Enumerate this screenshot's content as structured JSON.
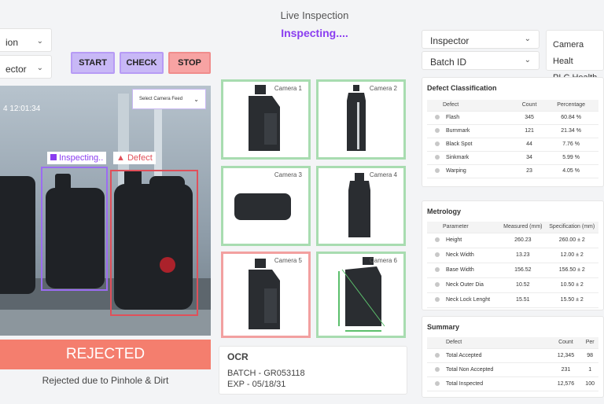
{
  "header": {
    "title": "Live Inspection",
    "status": "Inspecting...."
  },
  "left_controls": {
    "dropdown1_value": "ion",
    "dropdown2_value": "ector"
  },
  "buttons": {
    "start": "START",
    "check": "CHECK",
    "stop": "STOP"
  },
  "video": {
    "timestamp": "4  12:01:34",
    "camera_select": "Select Camera Feed",
    "inspecting_label": "Inspecting..",
    "defect_label": "Defect"
  },
  "result": {
    "verdict": "REJECTED",
    "reason": "Rejected due to Pinhole & Dirt"
  },
  "cameras": [
    {
      "label": "Camera 1",
      "status": "pass"
    },
    {
      "label": "Camera 2",
      "status": "pass"
    },
    {
      "label": "Camera 3",
      "status": "pass"
    },
    {
      "label": "Camera 4",
      "status": "pass"
    },
    {
      "label": "Camera 5",
      "status": "fail"
    },
    {
      "label": "Camera 6",
      "status": "pass"
    }
  ],
  "ocr": {
    "title": "OCR",
    "line1": "BATCH - GR053118",
    "line2": "EXP - 05/18/31"
  },
  "right_controls": {
    "inspector": "Inspector",
    "batch": "Batch ID",
    "camera_health": "Camera Healt",
    "plc_health": "PLC Health"
  },
  "defect_classification": {
    "title": "Defect Classification",
    "headers": [
      "Defect",
      "Count",
      "Percentage",
      ""
    ],
    "rows": [
      {
        "defect": "Flash",
        "count": "345",
        "pct": "60.84 %"
      },
      {
        "defect": "Burnmark",
        "count": "121",
        "pct": "21.34 %"
      },
      {
        "defect": "Black Spot",
        "count": "44",
        "pct": "7.76 %"
      },
      {
        "defect": "Sinkmark",
        "count": "34",
        "pct": "5.99 %"
      },
      {
        "defect": "Warping",
        "count": "23",
        "pct": "4.05 %"
      }
    ]
  },
  "metrology": {
    "title": "Metrology",
    "headers": [
      "Parameter",
      "Measured (mm)",
      "Specification (mm)",
      ""
    ],
    "rows": [
      {
        "param": "Height",
        "measured": "260.23",
        "spec": "260.00 ± 2"
      },
      {
        "param": "Neck Width",
        "measured": "13.23",
        "spec": "12.00 ± 2"
      },
      {
        "param": "Base Width",
        "measured": "156.52",
        "spec": "156.50 ± 2"
      },
      {
        "param": "Neck Outer Dia",
        "measured": "10.52",
        "spec": "10.50 ± 2"
      },
      {
        "param": "Neck Lock Lenght",
        "measured": "15.51",
        "spec": "15.50 ± 2"
      }
    ]
  },
  "summary": {
    "title": "Summary",
    "headers": [
      "Defect",
      "Count",
      "Per"
    ],
    "rows": [
      {
        "label": "Total Accepted",
        "count": "12,345",
        "pct": "98"
      },
      {
        "label": "Total Non Accepted",
        "count": "231",
        "pct": "1"
      },
      {
        "label": "Total Inspected",
        "count": "12,576",
        "pct": "100"
      }
    ]
  },
  "colors": {
    "accent_purple": "#8a3df0",
    "pass_green": "#a8dcb0",
    "fail_red": "#f2a0a0",
    "rejected_bg": "#f47e6e"
  }
}
